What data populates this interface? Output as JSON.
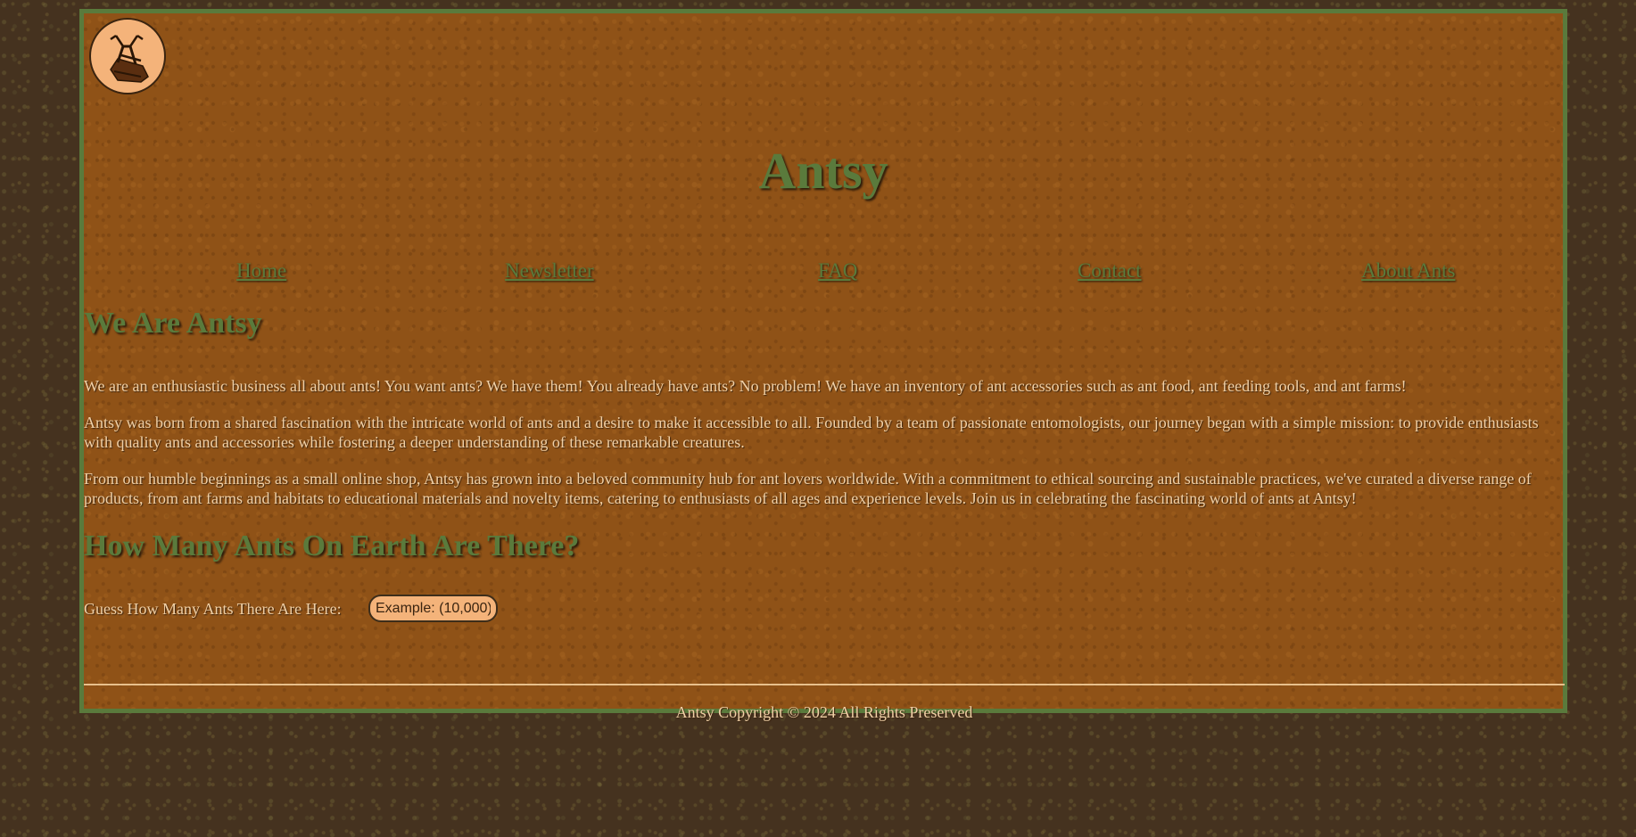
{
  "site": {
    "title": "Antsy",
    "logo_icon": "ant-farm-logo-icon"
  },
  "nav": {
    "items": [
      {
        "label": "Home"
      },
      {
        "label": "Newsletter"
      },
      {
        "label": "FAQ"
      },
      {
        "label": "Contact"
      },
      {
        "label": "About Ants"
      }
    ]
  },
  "about": {
    "heading": "We Are Antsy",
    "paragraphs": [
      "We are an enthusiastic business all about ants! You want ants? We have them! You already have ants? No problem! We have an inventory of ant accessories such as ant food, ant feeding tools, and ant farms!",
      "Antsy was born from a shared fascination with the intricate world of ants and a desire to make it accessible to all. Founded by a team of passionate entomologists, our journey began with a simple mission: to provide enthusiasts with quality ants and accessories while fostering a deeper understanding of these remarkable creatures.",
      "From our humble beginnings as a small online shop, Antsy has grown into a beloved community hub for ant lovers worldwide. With a commitment to ethical sourcing and sustainable practices, we've curated a diverse range of products, from ant farms and habitats to educational materials and novelty items, catering to enthusiasts of all ages and experience levels. Join us in celebrating the fascinating world of ants at Antsy!"
    ]
  },
  "quiz": {
    "heading": "How Many Ants On Earth Are There?",
    "label": "Guess How Many Ants There Are Here:",
    "input_value": "",
    "input_placeholder": "Example: (10,000)"
  },
  "footer": {
    "text": "Antsy Copyright © 2024 All Rights Preserved"
  },
  "colors": {
    "page_background": "#45321f",
    "panel_background": "#8f5217",
    "accent_green": "#5a7a3c",
    "body_text": "#f1d0a6",
    "input_background": "#f4b37a"
  }
}
